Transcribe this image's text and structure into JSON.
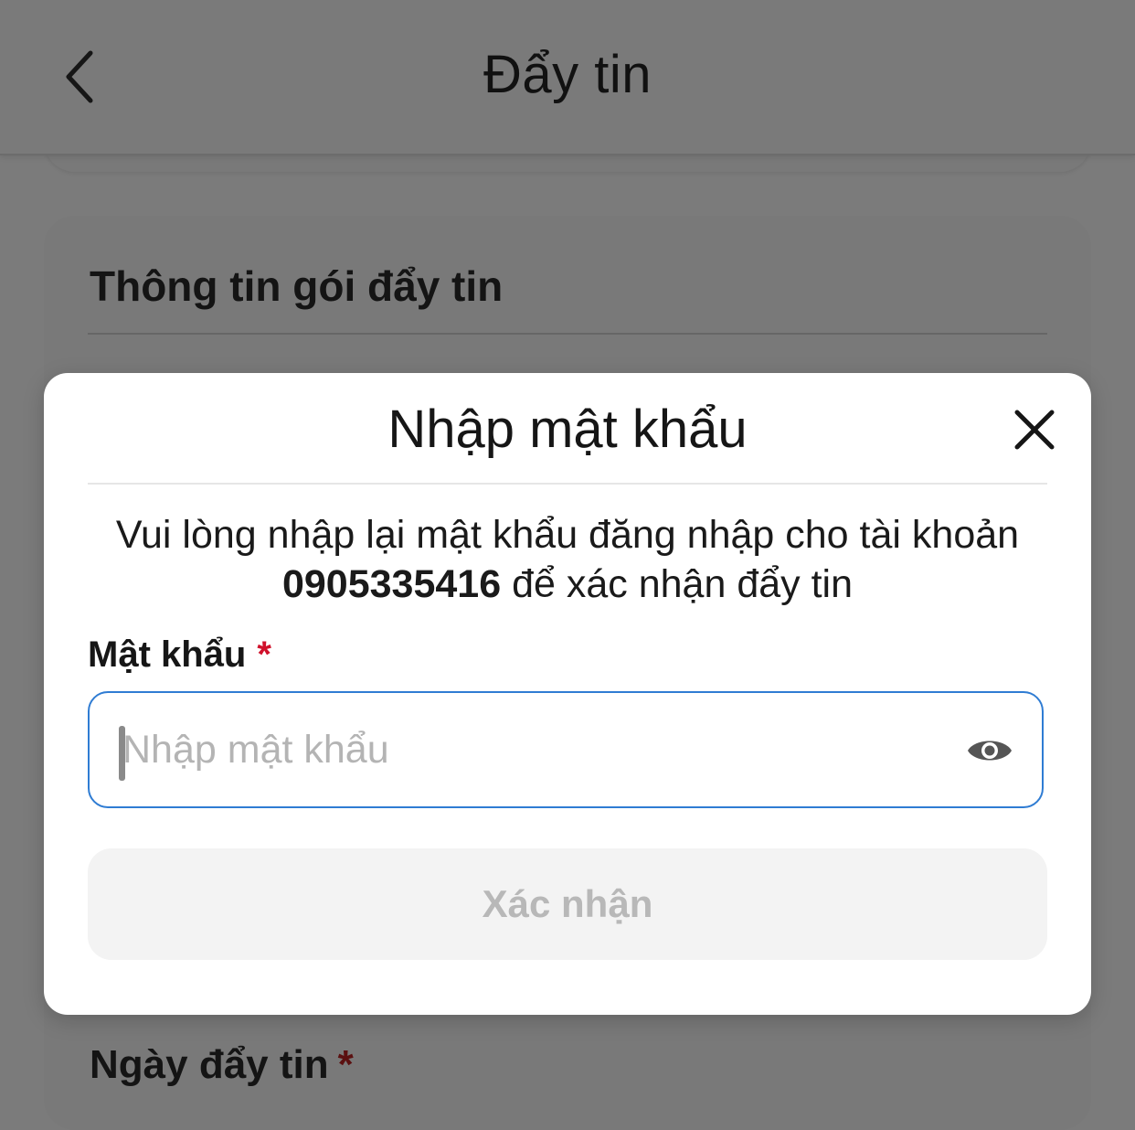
{
  "header": {
    "title": "Đẩy tin"
  },
  "background": {
    "section_title": "Thông tin gói đẩy tin",
    "bottom_label": "Ngày đẩy tin",
    "required_mark": "*"
  },
  "modal": {
    "title": "Nhập mật khẩu",
    "description_before": "Vui lòng nhập lại mật khẩu đăng nhập cho tài khoản",
    "phone": "0905335416",
    "description_after": "để xác nhận đẩy tin",
    "password_label": "Mật khẩu",
    "required_mark": "*",
    "password_placeholder": "Nhập mật khẩu",
    "password_value": "",
    "confirm_label": "Xác nhận"
  },
  "colors": {
    "overlay": "#7b7b7b",
    "input_border": "#2f7cd3",
    "required": "#d0112b",
    "disabled_button_bg": "#f3f3f3",
    "disabled_button_text": "#b8b8b8"
  },
  "icons": {
    "back": "chevron-left-icon",
    "close": "close-icon",
    "show_password": "eye-icon"
  }
}
